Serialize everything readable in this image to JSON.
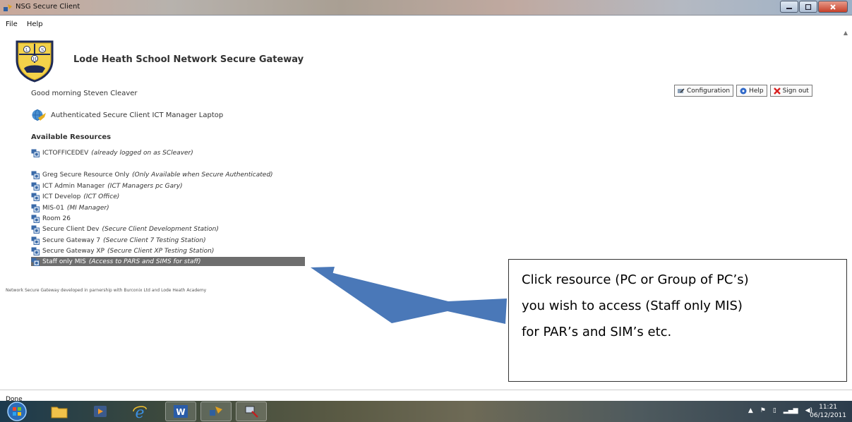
{
  "window": {
    "title": "NSG Secure Client"
  },
  "menu": {
    "file": "File",
    "help": "Help"
  },
  "header": {
    "title": "Lode Heath School Network Secure Gateway",
    "logo_letters": [
      "L",
      "H",
      "S"
    ]
  },
  "greeting": "Good morning Steven Cleaver",
  "actions": {
    "configuration": "Configuration",
    "help": "Help",
    "sign_out": "Sign out"
  },
  "auth_status": "Authenticated Secure Client ICT Manager Laptop",
  "available_heading": "Available Resources",
  "resources": [
    {
      "name": "ICTOFFICEDEV",
      "note": "(already logged on as SCleaver)"
    },
    {
      "name": "Greg Secure Resource Only",
      "note": "(Only Available when Secure Authenticated)"
    },
    {
      "name": "ICT Admin Manager",
      "note": "(ICT Managers pc Gary)"
    },
    {
      "name": "ICT Develop",
      "note": "(ICT Office)"
    },
    {
      "name": "MIS-01",
      "note": "(MI Manager)"
    },
    {
      "name": "Room 26",
      "note": ""
    },
    {
      "name": "Secure Client Dev",
      "note": "(Secure Client Development Station)"
    },
    {
      "name": "Secure Gateway 7",
      "note": "(Secure Client 7 Testing Station)"
    },
    {
      "name": "Secure Gateway XP",
      "note": "(Secure Client XP Testing Station)"
    },
    {
      "name": "Staff only MIS",
      "note": "(Access to PARS and SIMS for staff)"
    }
  ],
  "footer_note": "Network Secure Gateway developed in parnership with Burconix Ltd and Lode Heath Academy",
  "callout": {
    "line1": "Click resource (PC or Group of PC’s)",
    "line2": "you wish to access (Staff only MIS)",
    "line3": "for PAR’s and SIM’s etc."
  },
  "status": "Done",
  "taskbar": {
    "time": "11:21",
    "date": "06/12/2011"
  },
  "colors": {
    "selected_row": "#6e6e6e",
    "arrow": "#4a78b8",
    "shield": "#e1b82a"
  }
}
